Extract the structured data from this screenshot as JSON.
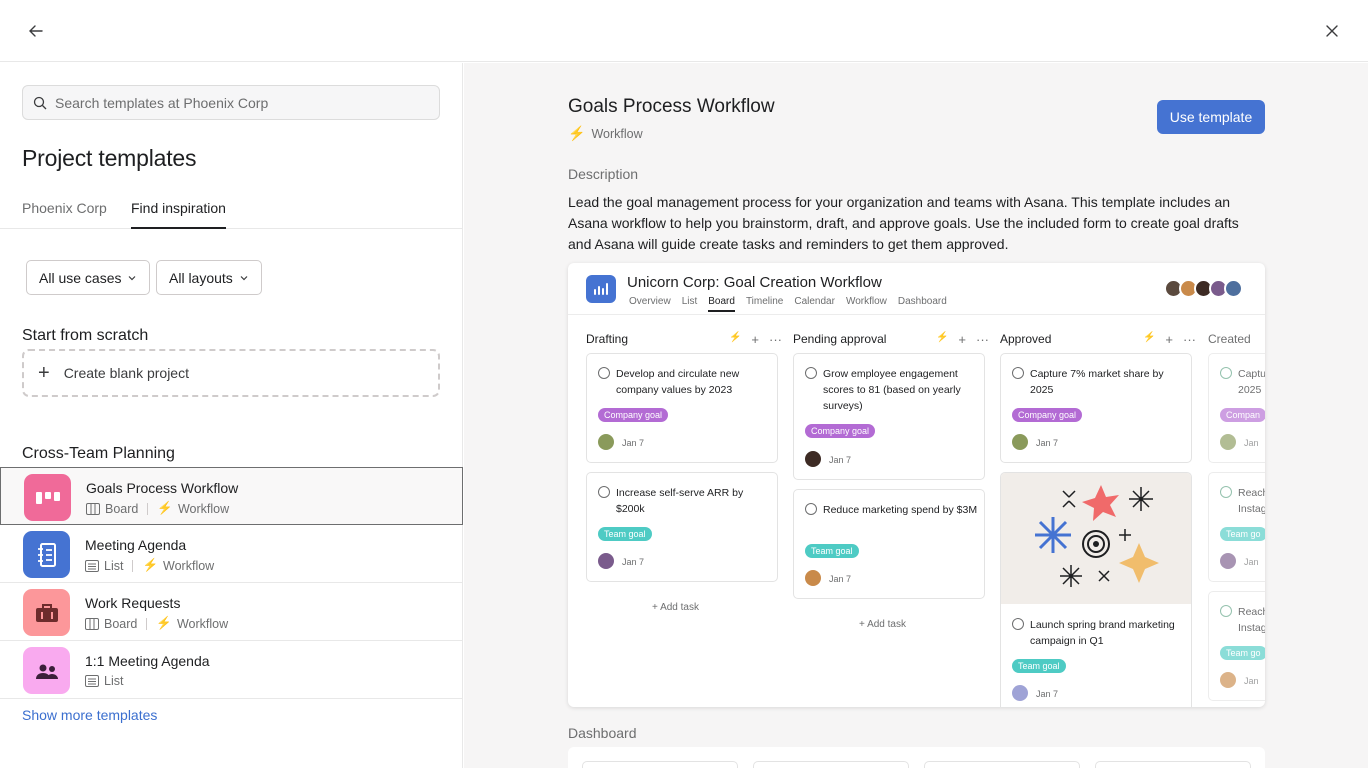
{
  "header": {
    "back_label": "Back",
    "close_label": "Close"
  },
  "left": {
    "search_placeholder": "Search templates at Phoenix Corp",
    "title": "Project templates",
    "tabs": [
      {
        "label": "Phoenix Corp"
      },
      {
        "label": "Find inspiration",
        "active": true
      }
    ],
    "filters": [
      {
        "label": "All use cases"
      },
      {
        "label": "All layouts"
      }
    ],
    "scratch_heading": "Start from scratch",
    "blank_label": "Create blank project",
    "group_heading": "Cross-Team Planning",
    "templates": [
      {
        "name": "Goals Process Workflow",
        "layout": "Board",
        "workflow": "Workflow",
        "icon": "board-icon",
        "color": "#f06a99",
        "selected": true
      },
      {
        "name": "Meeting Agenda",
        "layout": "List",
        "workflow": "Workflow",
        "icon": "notebook-icon",
        "color": "#4573d2"
      },
      {
        "name": "Work Requests",
        "layout": "Board",
        "workflow": "Workflow",
        "icon": "briefcase-icon",
        "color": "#fc979a"
      },
      {
        "name": "1:1 Meeting Agenda",
        "layout": "List",
        "icon": "people-icon",
        "color": "#f9aaef"
      }
    ],
    "show_more": "Show more templates"
  },
  "detail": {
    "title": "Goals Process Workflow",
    "type": "Workflow",
    "use_button": "Use template",
    "description_label": "Description",
    "description": "Lead the goal management process for your organization and teams with Asana. This template includes an Asana workflow to help you brainstorm, draft, and approve goals. Use the included form to create goal drafts and Asana will guide create tasks and reminders to get them approved.",
    "dashboard_label": "Dashboard",
    "preview": {
      "title": "Unicorn Corp: Goal Creation Workflow",
      "tabs": [
        "Overview",
        "List",
        "Board",
        "Timeline",
        "Calendar",
        "Workflow",
        "Dashboard"
      ],
      "active_tab": "Board",
      "add_task": "Add task",
      "columns": [
        {
          "name": "Drafting",
          "cards": [
            {
              "text": "Develop and circulate new company values by 2023",
              "tag": "Company goal",
              "date": "Jan 7"
            },
            {
              "text": "Increase self-serve ARR by $200k",
              "tag": "Team goal",
              "date": "Jan 7"
            }
          ]
        },
        {
          "name": "Pending approval",
          "cards": [
            {
              "text": "Grow employee engagement scores to 81 (based on yearly surveys)",
              "tag": "Company goal",
              "date": "Jan 7"
            },
            {
              "text": "Reduce marketing spend by $3M",
              "tag": "Team goal",
              "date": "Jan 7"
            }
          ]
        },
        {
          "name": "Approved",
          "cards": [
            {
              "text": "Capture 7% market share by 2025",
              "tag": "Company goal",
              "date": "Jan 7"
            },
            {
              "text": "Launch spring brand marketing campaign in Q1",
              "tag": "Team goal",
              "date": "Jan 7"
            }
          ]
        },
        {
          "name": "Created",
          "cards": [
            {
              "text": "Captu 2025",
              "tag": "Compan",
              "date": "Jan"
            },
            {
              "text": "Reach Instag",
              "tag": "Team go",
              "date": "Jan"
            },
            {
              "text": "Reach Instag",
              "tag": "Team go",
              "date": "Jan"
            }
          ]
        }
      ],
      "colors": {
        "company_goal": "#b36bd4",
        "team_goal": "#4ecbc4",
        "accent": "#4573d2"
      }
    }
  }
}
